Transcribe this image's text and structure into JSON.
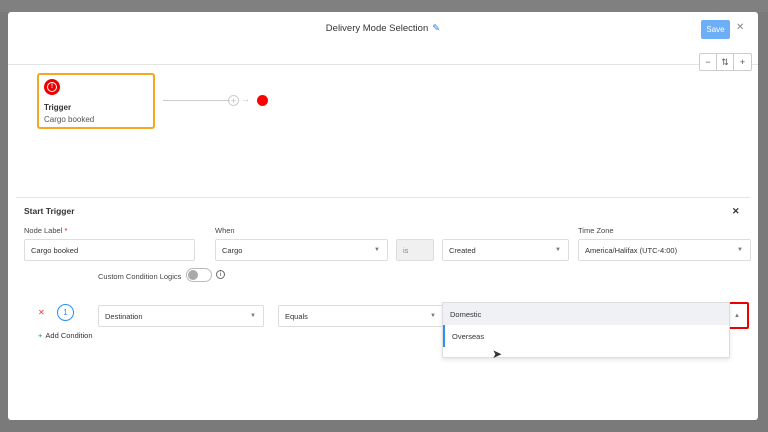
{
  "modal": {
    "title": "Delivery Mode Selection",
    "save_label": "Save",
    "close_icon": "x"
  },
  "canvas": {
    "zoom_out": "−",
    "fit": "⇅",
    "zoom_in": "+",
    "node": {
      "title": "Trigger",
      "subtitle": "Cargo booked"
    },
    "colors": {
      "node_border": "#f5a623",
      "end_node": "#ff0000"
    }
  },
  "panel": {
    "title": "Start Trigger",
    "node_label": {
      "label": "Node Label",
      "required": "*",
      "value": "Cargo booked"
    },
    "when": {
      "label": "When",
      "value": "Cargo",
      "operator": "is",
      "event": "Created"
    },
    "timezone": {
      "label": "Time Zone",
      "value": "America/Halifax (UTC-4:00)"
    },
    "custom_logic": {
      "label": "Custom Condition Logics",
      "enabled": false
    },
    "condition": {
      "index": "1",
      "field": "Destination",
      "operator": "Equals",
      "value": "|",
      "options": [
        "Domestic",
        "Overseas"
      ]
    },
    "add_condition": "Add Condition"
  }
}
